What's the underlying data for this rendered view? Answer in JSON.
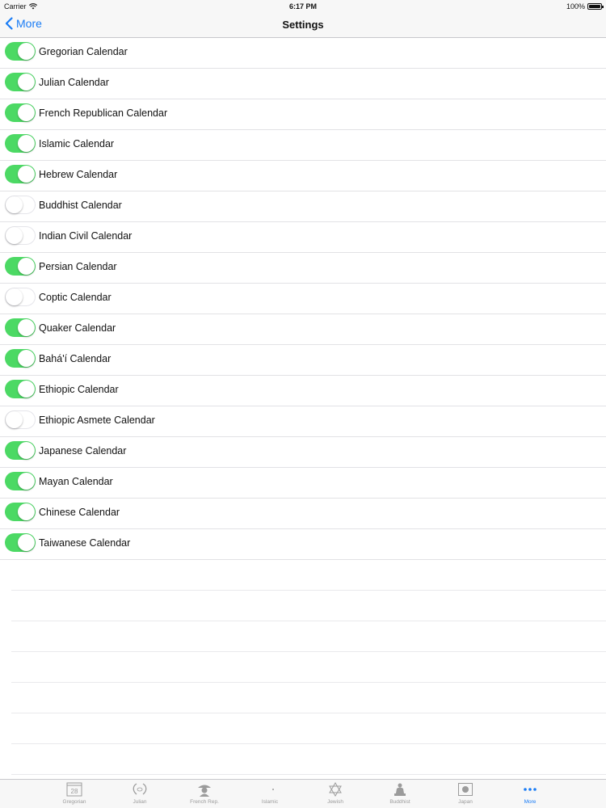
{
  "status_bar": {
    "carrier": "Carrier",
    "time": "6:17 PM",
    "battery": "100%"
  },
  "nav": {
    "back_label": "More",
    "title": "Settings"
  },
  "colors": {
    "toggle_on": "#4cd964",
    "accent": "#1a7cf5"
  },
  "calendars": [
    {
      "label": "Gregorian Calendar",
      "enabled": true
    },
    {
      "label": "Julian Calendar",
      "enabled": true
    },
    {
      "label": "French Republican Calendar",
      "enabled": true
    },
    {
      "label": "Islamic Calendar",
      "enabled": true
    },
    {
      "label": "Hebrew Calendar",
      "enabled": true
    },
    {
      "label": "Buddhist Calendar",
      "enabled": false
    },
    {
      "label": "Indian Civil Calendar",
      "enabled": false
    },
    {
      "label": "Persian Calendar",
      "enabled": true
    },
    {
      "label": "Coptic Calendar",
      "enabled": false
    },
    {
      "label": "Quaker Calendar",
      "enabled": true
    },
    {
      "label": "Bahá'í Calendar",
      "enabled": true
    },
    {
      "label": "Ethiopic Calendar",
      "enabled": true
    },
    {
      "label": "Ethiopic Asmete Calendar",
      "enabled": false
    },
    {
      "label": "Japanese Calendar",
      "enabled": true
    },
    {
      "label": "Mayan Calendar",
      "enabled": true
    },
    {
      "label": "Chinese Calendar",
      "enabled": true
    },
    {
      "label": "Taiwanese Calendar",
      "enabled": true
    }
  ],
  "tabs": [
    {
      "label": "Gregorian",
      "icon": "calendar-icon",
      "icon_text": "28",
      "active": false
    },
    {
      "label": "Julian",
      "icon": "laurel-icon",
      "active": false
    },
    {
      "label": "French Rep.",
      "icon": "napoleon-icon",
      "active": false
    },
    {
      "label": "Islamic",
      "icon": "crescent-icon",
      "active": false
    },
    {
      "label": "Jewish",
      "icon": "star-of-david-icon",
      "active": false
    },
    {
      "label": "Buddhist",
      "icon": "buddha-icon",
      "active": false
    },
    {
      "label": "Japan",
      "icon": "japan-flag-icon",
      "active": false
    },
    {
      "label": "More",
      "icon": "more-icon",
      "active": true
    }
  ]
}
